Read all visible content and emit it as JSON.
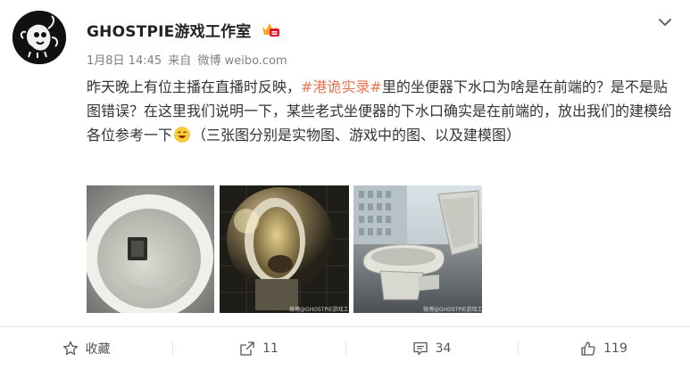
{
  "post": {
    "author": "GHOSTPIE游戏工作室",
    "date": "1月8日 14:45",
    "source_prefix": "来自",
    "source": "微博 weibo.com",
    "text_part1": "昨天晚上有位主播在直播时反映，",
    "hashtag": "#港诡实录#",
    "text_part2": "里的坐便器下水口为啥是在前端的？是不是贴图错误？在这里我们说明一下，某些老式坐便器的下水口确实是在前端的，放出我们的建模给各位参考一下",
    "text_part3": "（三张图分别是实物图、游戏中的图、以及建模图）",
    "emoji": "laughing-emoji"
  },
  "photos": [
    {
      "name": "toilet-real-photo",
      "watermark": ""
    },
    {
      "name": "toilet-game-screenshot",
      "watermark": "微博@GHOSTPIE游戏工作室"
    },
    {
      "name": "toilet-model-render",
      "watermark": "微博@GHOSTPIE游戏工作室"
    }
  ],
  "footer": {
    "favorite_label": "收藏",
    "repost_count": "11",
    "comment_count": "34",
    "like_count": "119"
  },
  "icons": [
    "vip-badge-icon",
    "chevron-down-icon",
    "star-icon",
    "share-icon",
    "comment-icon",
    "thumbs-up-icon"
  ],
  "colors": {
    "hashtag": "#eb7350",
    "meta": "#808080",
    "text": "#333333"
  }
}
